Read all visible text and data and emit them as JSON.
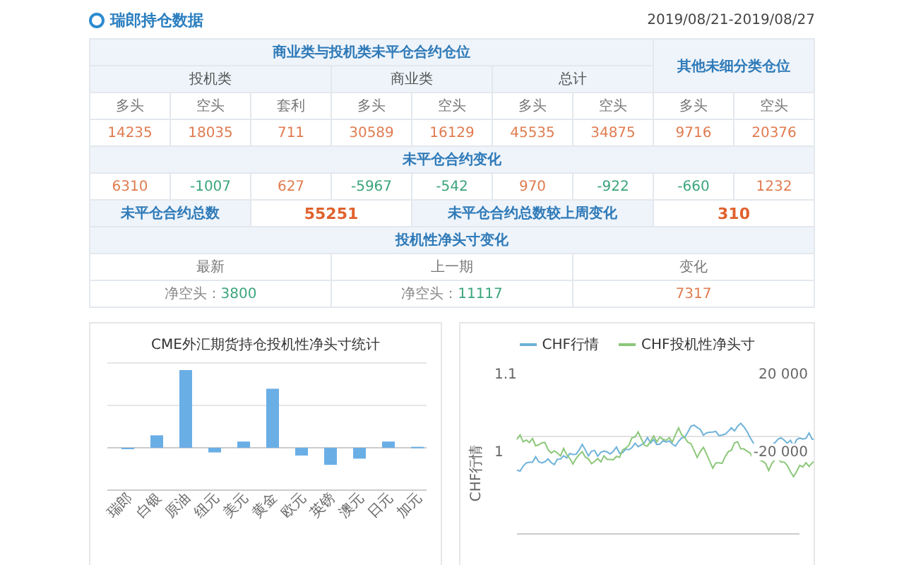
{
  "header": {
    "title": "瑞郎持仓数据",
    "date_range": "2019/08/21-2019/08/27"
  },
  "table": {
    "group_title": "商业类与投机类未平仓合约仓位",
    "other_title": "其他未细分类仓位",
    "groups": [
      "投机类",
      "商业类",
      "总计"
    ],
    "columns": [
      "多头",
      "空头",
      "套利",
      "多头",
      "空头",
      "多头",
      "空头",
      "多头",
      "空头"
    ],
    "positions": [
      {
        "text": "14235",
        "color": "#e07b4f"
      },
      {
        "text": "18035",
        "color": "#e07b4f"
      },
      {
        "text": "711",
        "color": "#e07b4f"
      },
      {
        "text": "30589",
        "color": "#e07b4f"
      },
      {
        "text": "16129",
        "color": "#e07b4f"
      },
      {
        "text": "45535",
        "color": "#e07b4f"
      },
      {
        "text": "34875",
        "color": "#e07b4f"
      },
      {
        "text": "9716",
        "color": "#e07b4f"
      },
      {
        "text": "20376",
        "color": "#e07b4f"
      }
    ],
    "change_title": "未平仓合约变化",
    "changes": [
      {
        "text": "6310",
        "color": "#e07b4f"
      },
      {
        "text": "-1007",
        "color": "#3aa57a"
      },
      {
        "text": "627",
        "color": "#e07b4f"
      },
      {
        "text": "-5967",
        "color": "#3aa57a"
      },
      {
        "text": "-542",
        "color": "#3aa57a"
      },
      {
        "text": "970",
        "color": "#e07b4f"
      },
      {
        "text": "-922",
        "color": "#3aa57a"
      },
      {
        "text": "-660",
        "color": "#3aa57a"
      },
      {
        "text": "1232",
        "color": "#e07b4f"
      }
    ],
    "total_label": "未平仓合约总数",
    "total_value": "55251",
    "weekly_label": "未平仓合约总数较上周变化",
    "weekly_value": "310",
    "net_title": "投机性净头寸变化",
    "net_columns": [
      "最新",
      "上一期",
      "变化"
    ],
    "net_values": [
      {
        "label": "净空头：",
        "value": "3800",
        "color": "#3aa57a"
      },
      {
        "label": "净空头：",
        "value": "11117",
        "color": "#3aa57a"
      },
      {
        "value": "7317",
        "color": "#e07b4f"
      }
    ]
  },
  "bar_chart": {
    "title": "CME外汇期货持仓投机性净头寸统计",
    "categories": [
      "瑞郎",
      "白银",
      "原油",
      "纽元",
      "美元",
      "黄金",
      "欧元",
      "英镑",
      "澳元",
      "日元",
      "加元"
    ]
  },
  "line_chart": {
    "legend": [
      {
        "name": "CHF行情",
        "color": "#6fb2d8"
      },
      {
        "name": "CHF投机性净头寸",
        "color": "#8cc77a"
      }
    ],
    "ylabel": "CHF行情",
    "left_ticks": [
      "1.1",
      "1"
    ],
    "right_ticks": [
      "20 000",
      "-20 000"
    ]
  }
}
